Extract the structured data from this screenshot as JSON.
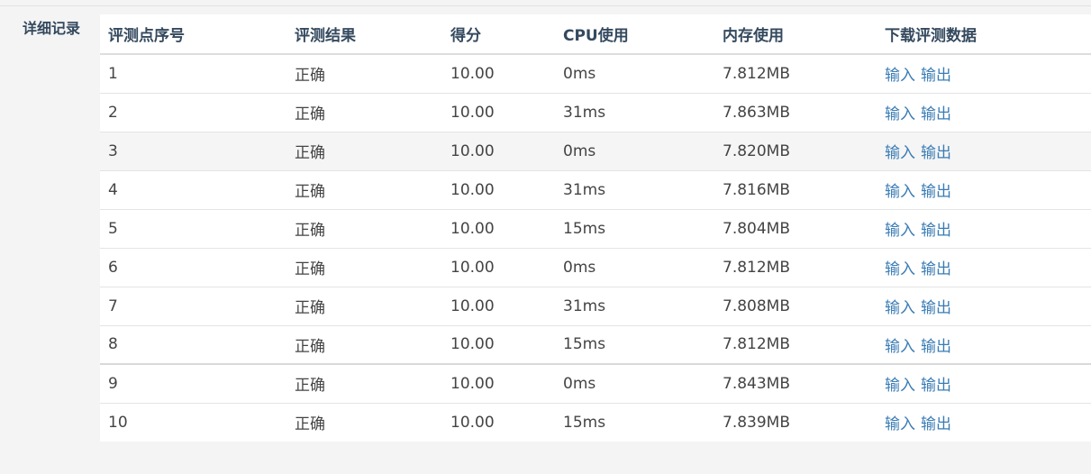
{
  "section": {
    "label": "详细记录"
  },
  "table": {
    "headers": [
      "评测点序号",
      "评测结果",
      "得分",
      "CPU使用",
      "内存使用",
      "下载评测数据"
    ],
    "rows": [
      {
        "index": "1",
        "result": "正确",
        "score": "10.00",
        "cpu": "0ms",
        "memory": "7.812MB",
        "input_link": "输入",
        "output_link": "输出"
      },
      {
        "index": "2",
        "result": "正确",
        "score": "10.00",
        "cpu": "31ms",
        "memory": "7.863MB",
        "input_link": "输入",
        "output_link": "输出"
      },
      {
        "index": "3",
        "result": "正确",
        "score": "10.00",
        "cpu": "0ms",
        "memory": "7.820MB",
        "input_link": "输入",
        "output_link": "输出"
      },
      {
        "index": "4",
        "result": "正确",
        "score": "10.00",
        "cpu": "31ms",
        "memory": "7.816MB",
        "input_link": "输入",
        "output_link": "输出"
      },
      {
        "index": "5",
        "result": "正确",
        "score": "10.00",
        "cpu": "15ms",
        "memory": "7.804MB",
        "input_link": "输入",
        "output_link": "输出"
      },
      {
        "index": "6",
        "result": "正确",
        "score": "10.00",
        "cpu": "0ms",
        "memory": "7.812MB",
        "input_link": "输入",
        "output_link": "输出"
      },
      {
        "index": "7",
        "result": "正确",
        "score": "10.00",
        "cpu": "31ms",
        "memory": "7.808MB",
        "input_link": "输入",
        "output_link": "输出"
      },
      {
        "index": "8",
        "result": "正确",
        "score": "10.00",
        "cpu": "15ms",
        "memory": "7.812MB",
        "input_link": "输入",
        "output_link": "输出"
      },
      {
        "index": "9",
        "result": "正确",
        "score": "10.00",
        "cpu": "0ms",
        "memory": "7.843MB",
        "input_link": "输入",
        "output_link": "输出"
      },
      {
        "index": "10",
        "result": "正确",
        "score": "10.00",
        "cpu": "15ms",
        "memory": "7.839MB",
        "input_link": "输入",
        "output_link": "输出"
      }
    ]
  },
  "colors": {
    "link": "#3a7cb5",
    "header_text": "#34495e",
    "page_bg": "#f4f4f4"
  }
}
